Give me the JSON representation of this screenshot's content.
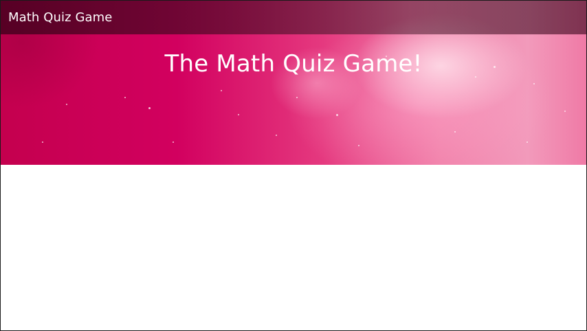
{
  "navbar": {
    "brand": "Math Quiz Game"
  },
  "hero": {
    "title": "The Math Quiz Game!"
  },
  "colors": {
    "hero_pink": "#d2005f",
    "hero_light_pink": "#f29abb",
    "navbar_dark": "#46001e",
    "text": "#ffffff"
  }
}
